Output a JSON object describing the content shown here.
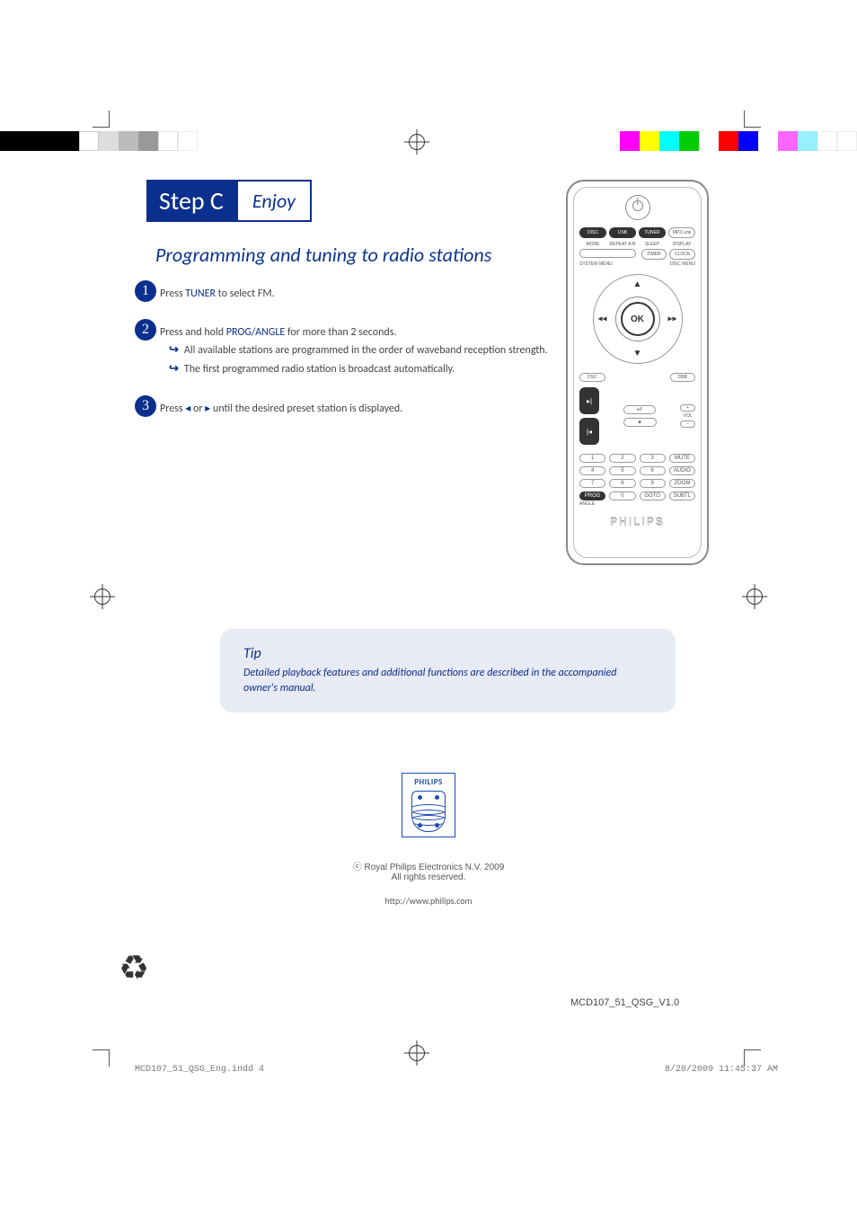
{
  "header": {
    "step_label": "Step C",
    "enjoy_label": "Enjoy"
  },
  "section_title": "Programming and tuning to radio stations",
  "steps": {
    "s1": {
      "num": "1",
      "text_pre": "Press ",
      "key": "TUNER",
      "text_post": " to select FM."
    },
    "s2": {
      "num": "2",
      "text_pre": "Press and hold ",
      "key": "PROG/ANGLE",
      "text_post": " for more than 2 seconds.",
      "b1": "All available stations are programmed in the order of waveband reception strength.",
      "b2": "The first programmed radio station is broadcast automatically."
    },
    "s3": {
      "num": "3",
      "text_pre": "Press ",
      "icon_l": "◂",
      "mid": " or ",
      "icon_r": "▸",
      "text_post": " until the desired preset station is displayed."
    }
  },
  "remote": {
    "sources": {
      "disc": "DISC",
      "usb": "USB",
      "tuner": "TUNER",
      "mp3": "MP3 Link"
    },
    "row2": {
      "c1": "MODE",
      "c2": "REPEAT A-B",
      "c3": "SLEEP",
      "c4": "DISPLAY"
    },
    "row3": {
      "c3": "TIMER",
      "c4": "CLOCK"
    },
    "menus": {
      "left": "SYSTEM MENU",
      "right": "DISC MENU"
    },
    "ok": "OK",
    "pills": {
      "left": "DSC",
      "right": "DBB"
    },
    "vol_label": "VOL",
    "angle_label": "ANGLE",
    "num": {
      "n1": "1",
      "n2": "2",
      "n3": "3",
      "n4": "4",
      "n5": "5",
      "n6": "6",
      "n7": "7",
      "n8": "8",
      "n9": "9",
      "n0": "0",
      "prog": "PROG",
      "goto": "GOTO",
      "mute": "MUTE",
      "audio": "AUDIO",
      "zoom": "ZOOM",
      "subtl": "SUBTL"
    },
    "brand": "PHILIPS"
  },
  "tip": {
    "title": "Tip",
    "body": "Detailed playback features and additional functions are described in the accompanied owner's manual."
  },
  "logo_word": "PHILIPS",
  "copyright_symbol": "ⓒ",
  "copyright_line1": "Royal Philips Electronics N.V. 2009",
  "copyright_line2": "All rights reserved.",
  "url": "http://www.philips.com",
  "doc_id": "MCD107_51_QSG_V1.0",
  "footer_file": "MCD107_51_QSG_Eng.indd   4",
  "footer_date": "8/20/2009   11:45:37 AM",
  "colorbar": {
    "left": [
      "#000",
      "#000",
      "#000",
      "#000",
      "#fff",
      "#ccc",
      "#aaa",
      "#888",
      "#fff",
      "#fff"
    ],
    "right": [
      "#f0f",
      "#ff0",
      "#0ff",
      "#0d0",
      "#fff",
      "#f00",
      "#00f",
      "#fff",
      "#f0f",
      "#0ff",
      "#fff",
      "#fff"
    ]
  }
}
